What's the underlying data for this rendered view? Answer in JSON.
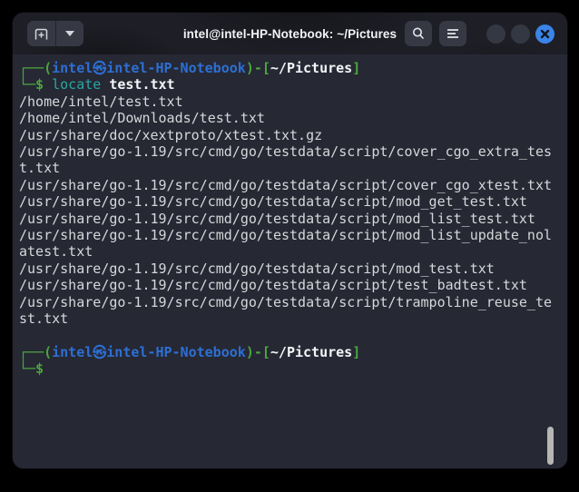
{
  "window": {
    "title": "intel@intel-HP-Notebook: ~/Pictures",
    "controls": {
      "new_tab": "new-tab-icon",
      "tab_dropdown": "chevron-down-icon",
      "search": "magnifier-icon",
      "menu": "hamburger-menu-icon",
      "minimize": "blank-circle",
      "maximize": "blank-circle",
      "close": "close-x-icon"
    }
  },
  "colors": {
    "terminal_background": "#262834",
    "titlebar_background": "#1e1f26",
    "prompt_frame_green": "#4da53f",
    "user_host_blue": "#2d6fd3",
    "command_teal": "#28a8a2",
    "output_text": "#d5d7da",
    "bold_white": "#f4f5f6",
    "close_button_blue": "#3b84e8",
    "scrollbar_thumb": "#b6b6b6"
  },
  "terminal": {
    "columns": 65,
    "prompt_user": "intel",
    "prompt_host": "intel-HP-Notebook",
    "prompt_path": "~/Pictures",
    "command": "locate test.txt",
    "lines": [
      {
        "segments": [
          {
            "t": "┌──(",
            "c": "green"
          },
          {
            "t": "intel㉿intel-HP-Notebook",
            "c": "blue"
          },
          {
            "t": ")-[",
            "c": "green"
          },
          {
            "t": "~/Pictures",
            "c": "bold"
          },
          {
            "t": "]",
            "c": "green"
          }
        ]
      },
      {
        "segments": [
          {
            "t": "└─$ ",
            "c": "green"
          },
          {
            "t": "locate ",
            "c": "teal"
          },
          {
            "t": "test.txt",
            "c": "bold"
          }
        ]
      },
      {
        "segments": [
          {
            "t": "/home/intel/test.txt",
            "c": "fg"
          }
        ]
      },
      {
        "segments": [
          {
            "t": "/home/intel/Downloads/test.txt",
            "c": "fg"
          }
        ]
      },
      {
        "segments": [
          {
            "t": "/usr/share/doc/xextproto/xtest.txt.gz",
            "c": "fg"
          }
        ]
      },
      {
        "segments": [
          {
            "t": "/usr/share/go-1.19/src/cmd/go/testdata/script/cover_cgo_extra_test.txt",
            "c": "fg"
          }
        ]
      },
      {
        "segments": [
          {
            "t": "/usr/share/go-1.19/src/cmd/go/testdata/script/cover_cgo_xtest.txt",
            "c": "fg"
          }
        ]
      },
      {
        "segments": [
          {
            "t": "/usr/share/go-1.19/src/cmd/go/testdata/script/mod_get_test.txt",
            "c": "fg"
          }
        ]
      },
      {
        "segments": [
          {
            "t": "/usr/share/go-1.19/src/cmd/go/testdata/script/mod_list_test.txt",
            "c": "fg"
          }
        ]
      },
      {
        "segments": [
          {
            "t": "/usr/share/go-1.19/src/cmd/go/testdata/script/mod_list_update_nolatest.txt",
            "c": "fg"
          }
        ]
      },
      {
        "segments": [
          {
            "t": "/usr/share/go-1.19/src/cmd/go/testdata/script/mod_test.txt",
            "c": "fg"
          }
        ]
      },
      {
        "segments": [
          {
            "t": "/usr/share/go-1.19/src/cmd/go/testdata/script/test_badtest.txt",
            "c": "fg"
          }
        ]
      },
      {
        "segments": [
          {
            "t": "/usr/share/go-1.19/src/cmd/go/testdata/script/trampoline_reuse_test.txt",
            "c": "fg"
          }
        ]
      },
      {
        "segments": []
      },
      {
        "segments": [
          {
            "t": "┌──(",
            "c": "green"
          },
          {
            "t": "intel㉿intel-HP-Notebook",
            "c": "blue"
          },
          {
            "t": ")-[",
            "c": "green"
          },
          {
            "t": "~/Pictures",
            "c": "bold"
          },
          {
            "t": "]",
            "c": "green"
          }
        ]
      },
      {
        "segments": [
          {
            "t": "└─$",
            "c": "green"
          }
        ]
      }
    ]
  }
}
